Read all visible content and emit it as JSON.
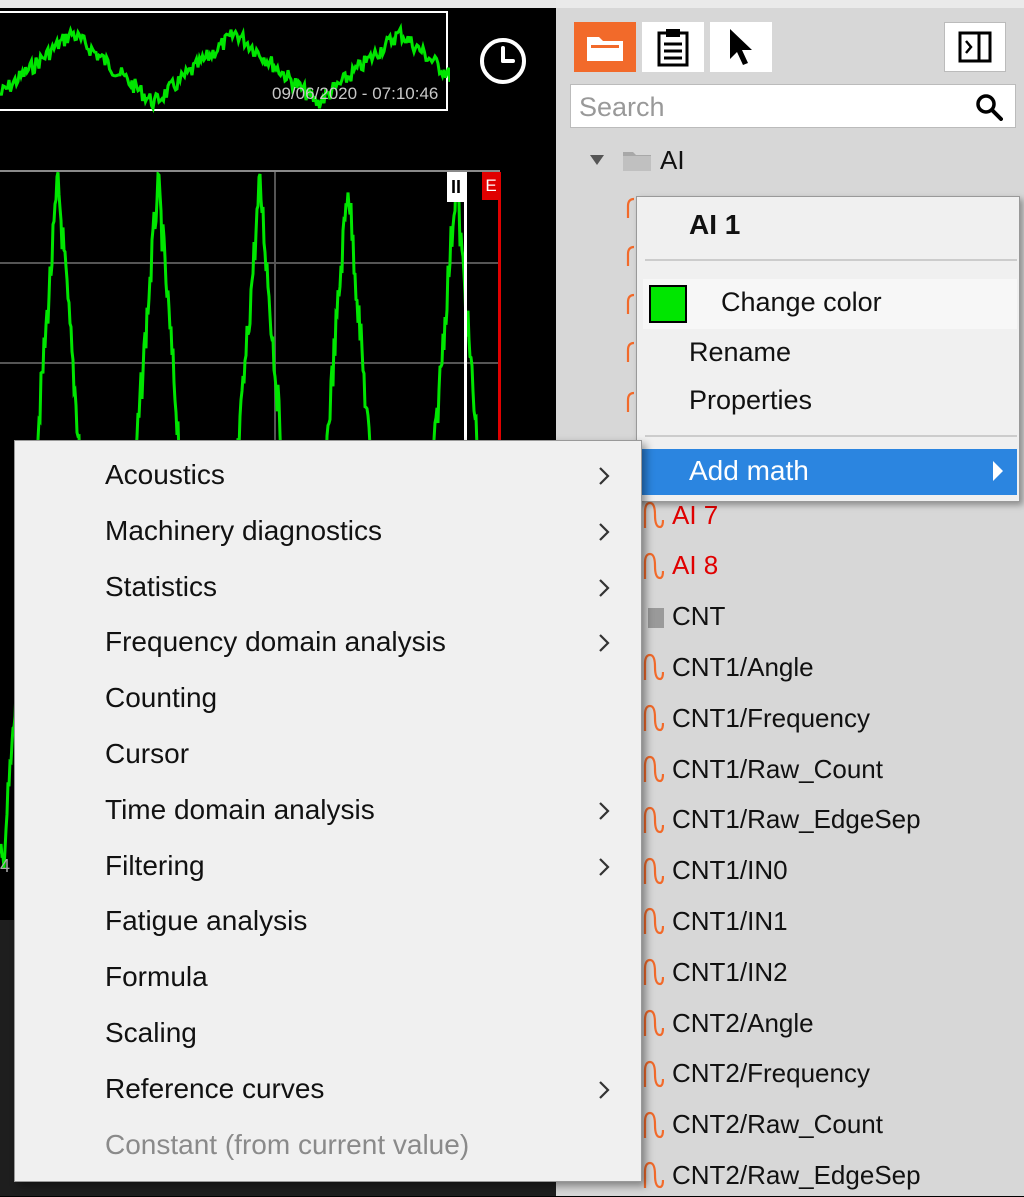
{
  "overview": {
    "timestamp": "09/06/2020 - 07:10:46"
  },
  "plot": {
    "cursor_a_label": "II",
    "cursor_b_label": "E",
    "axis_partial_label": "4",
    "trace_color": "#00e600",
    "cursor_b_color": "#e00000"
  },
  "toolbar": {
    "buttons": [
      "folder-icon",
      "clipboard-icon",
      "pointer-icon",
      "panel-toggle-icon"
    ],
    "accent": "#f26a2a"
  },
  "search": {
    "placeholder": "Search",
    "value": ""
  },
  "tree": {
    "group_label": "AI",
    "items": [
      {
        "label": "AI 7",
        "color": "red"
      },
      {
        "label": "AI 8",
        "color": "red"
      },
      {
        "label": "CNT",
        "type": "group"
      },
      {
        "label": "CNT1/Angle"
      },
      {
        "label": "CNT1/Frequency"
      },
      {
        "label": "CNT1/Raw_Count"
      },
      {
        "label": "CNT1/Raw_EdgeSep"
      },
      {
        "label": "CNT1/IN0"
      },
      {
        "label": "CNT1/IN1"
      },
      {
        "label": "CNT1/IN2"
      },
      {
        "label": "CNT2/Angle"
      },
      {
        "label": "CNT2/Frequency"
      },
      {
        "label": "CNT2/Raw_Count"
      },
      {
        "label": "CNT2/Raw_EdgeSep"
      }
    ]
  },
  "channel_menu": {
    "title": "AI 1",
    "change_color": "Change color",
    "swatch_color": "#00e600",
    "rename": "Rename",
    "properties": "Properties",
    "add_math": "Add math"
  },
  "math_menu": {
    "items": [
      {
        "label": "Acoustics",
        "submenu": true
      },
      {
        "label": "Machinery diagnostics",
        "submenu": true
      },
      {
        "label": "Statistics",
        "submenu": true
      },
      {
        "label": "Frequency domain analysis",
        "submenu": true
      },
      {
        "label": "Counting",
        "submenu": false
      },
      {
        "label": "Cursor",
        "submenu": false
      },
      {
        "label": "Time domain analysis",
        "submenu": true
      },
      {
        "label": "Filtering",
        "submenu": true
      },
      {
        "label": "Fatigue analysis",
        "submenu": false
      },
      {
        "label": "Formula",
        "submenu": false
      },
      {
        "label": "Scaling",
        "submenu": false
      },
      {
        "label": "Reference curves",
        "submenu": true
      },
      {
        "label": "Constant (from current value)",
        "submenu": false,
        "disabled": true
      }
    ]
  }
}
